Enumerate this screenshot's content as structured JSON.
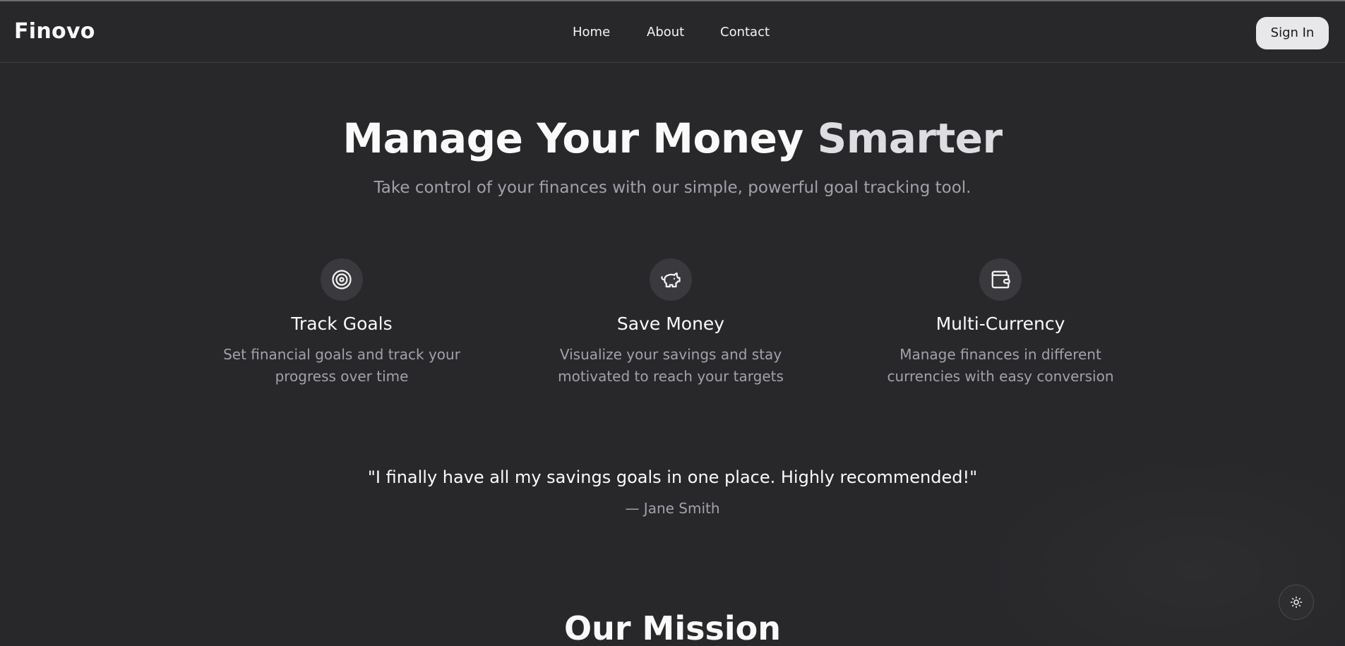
{
  "header": {
    "logo": "Finovo",
    "nav": [
      {
        "label": "Home"
      },
      {
        "label": "About"
      },
      {
        "label": "Contact"
      }
    ],
    "sign_in_label": "Sign In"
  },
  "hero": {
    "title_main": "Manage Your Money ",
    "title_accent": "Smarter",
    "subtitle": "Take control of your finances with our simple, powerful goal tracking tool."
  },
  "features": [
    {
      "icon": "target-icon",
      "title": "Track Goals",
      "description": "Set financial goals and track your progress over time"
    },
    {
      "icon": "piggy-bank-icon",
      "title": "Save Money",
      "description": "Visualize your savings and stay motivated to reach your targets"
    },
    {
      "icon": "wallet-icon",
      "title": "Multi-Currency",
      "description": "Manage finances in different currencies with easy conversion"
    }
  ],
  "testimonial": {
    "quote": "\"I finally have all my savings goals in one place. Highly recommended!\"",
    "author": "— Jane Smith"
  },
  "mission": {
    "heading": "Our Mission"
  },
  "theme_toggle": {
    "icon": "sun-icon"
  },
  "colors": {
    "background": "#28282b",
    "text": "#fafafa",
    "muted_text": "#a1a1aa",
    "icon_circle": "#3a3a3e",
    "button_bg": "#e8e8ea"
  }
}
